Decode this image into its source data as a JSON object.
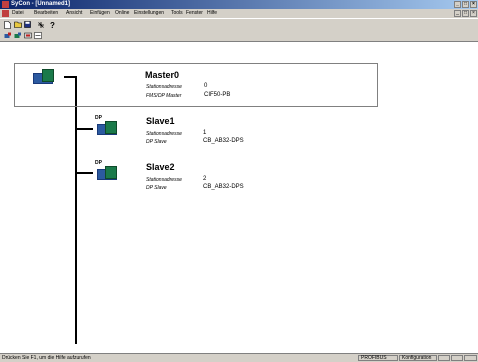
{
  "window": {
    "title": "SyCon - [Unnamed1]"
  },
  "menu": [
    "Datei",
    "Bearbeiten",
    "Ansicht",
    "Einfügen",
    "Online",
    "Einstellungen",
    "Tools",
    "Fenster",
    "Hilfe"
  ],
  "toolbar1": [
    "new-file-icon",
    "open-file-icon",
    "save-icon",
    "network-view-icon",
    "help-icon"
  ],
  "toolbar2": [
    "insert-master-icon",
    "insert-slave-icon",
    "insert-module-icon",
    "fieldbus-icon"
  ],
  "master": {
    "name": "Master0",
    "station_label": "Stationsadresse",
    "station_value": "0",
    "type_label": "FMS/DP Master",
    "type_value": "CIF50-PB"
  },
  "slaves": [
    {
      "badge": "DP",
      "name": "Slave1",
      "station_label": "Stationsadresse",
      "station_value": "1",
      "type_label": "DP Slave",
      "type_value": "CB_AB32-DPS"
    },
    {
      "badge": "DP",
      "name": "Slave2",
      "station_label": "Stationsadresse",
      "station_value": "2",
      "type_label": "DP Slave",
      "type_value": "CB_AB32-DPS"
    }
  ],
  "status": {
    "help_text": "Drücken Sie F1, um die Hilfe aufzurufen",
    "protocol": "PROFIBUS",
    "mode": "Konfiguration"
  }
}
